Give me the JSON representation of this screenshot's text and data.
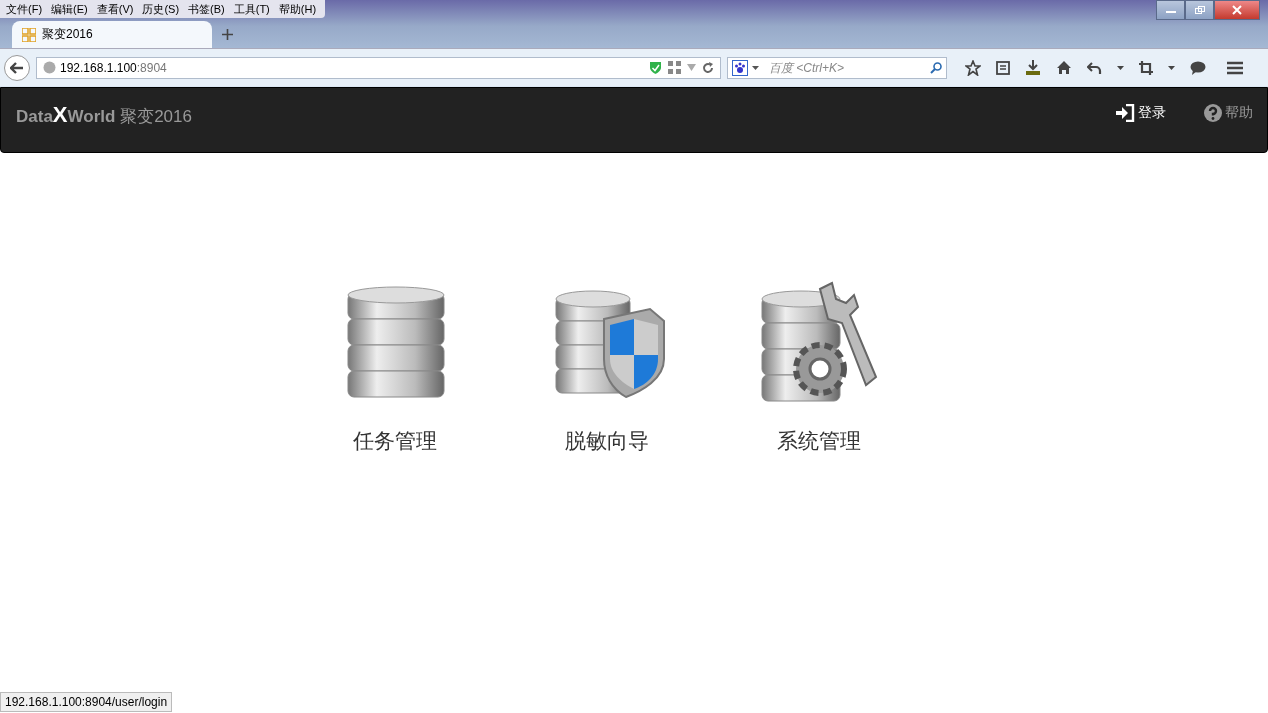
{
  "browser": {
    "menu": [
      "文件(F)",
      "编辑(E)",
      "查看(V)",
      "历史(S)",
      "书签(B)",
      "工具(T)",
      "帮助(H)"
    ],
    "tab": {
      "title": "聚变2016"
    },
    "address": {
      "host": "192.168.1.100",
      "port": ":8904"
    },
    "search": {
      "placeholder": "百度 <Ctrl+K>"
    },
    "status_url": "192.168.1.100:8904/user/login"
  },
  "navbar": {
    "brand": {
      "prefix": "Data",
      "mark": "X",
      "suffix": "World",
      "subtitle": "聚变2016"
    },
    "links": [
      {
        "label": "登录",
        "kind": "login",
        "active": true
      },
      {
        "label": "帮助",
        "kind": "help",
        "active": false
      }
    ]
  },
  "tiles": [
    {
      "label": "任务管理",
      "kind": "database"
    },
    {
      "label": "脱敏向导",
      "kind": "shield"
    },
    {
      "label": "系统管理",
      "kind": "tools"
    }
  ]
}
